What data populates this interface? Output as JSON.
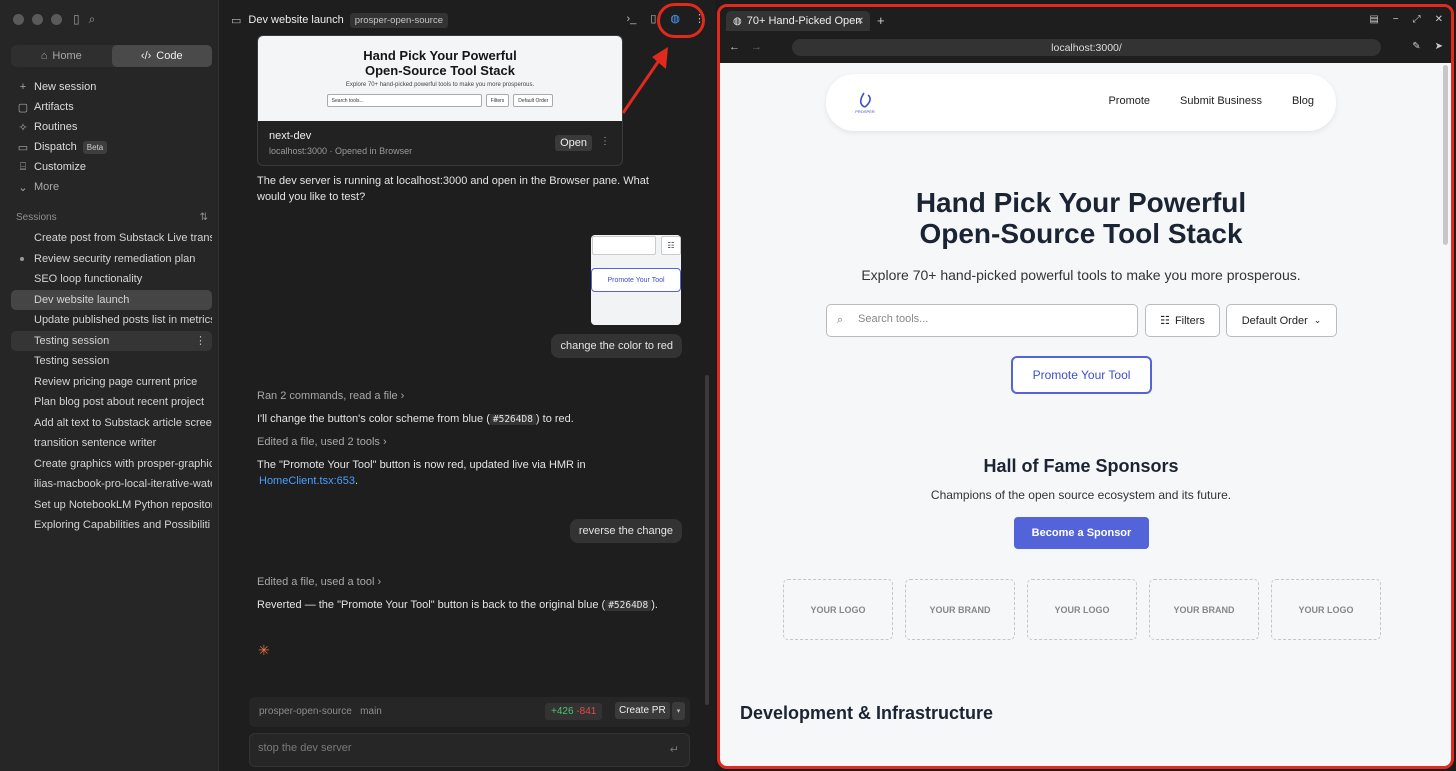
{
  "sidebar": {
    "tabs": [
      {
        "label": "Home",
        "icon": "home-icon"
      },
      {
        "label": "Code",
        "icon": "code-icon"
      }
    ],
    "nav": [
      {
        "label": "New session",
        "icon": "plus-icon"
      },
      {
        "label": "Artifacts",
        "icon": "artifacts-icon"
      },
      {
        "label": "Routines",
        "icon": "routines-icon"
      },
      {
        "label": "Dispatch",
        "icon": "dispatch-icon",
        "badge": "Beta"
      },
      {
        "label": "Customize",
        "icon": "customize-icon"
      },
      {
        "label": "More",
        "icon": "chevron-down-icon"
      }
    ],
    "sessions_label": "Sessions",
    "sessions": [
      "Create post from Substack Live trans",
      "Review security remediation plan",
      "SEO loop functionality",
      "Dev website launch",
      "Update published posts list in metrics",
      "Testing session",
      "Testing session",
      "Review pricing page current price",
      "Plan blog post about recent project",
      "Add alt text to Substack article scree",
      "transition sentence writer",
      "Create graphics with prosper-graphic",
      "ilias-macbook-pro-local-iterative-wate",
      "Set up NotebookLM Python repositor",
      "Exploring Capabilities and Possibiliti"
    ]
  },
  "chat": {
    "title": "Dev website launch",
    "repo": "prosper-open-source",
    "preview": {
      "heading": "Hand Pick Your Powerful Open-Source Tool Stack",
      "sub": "Explore 70+ hand-picked powerful tools to make you more prosperous.",
      "search": "Search tools...",
      "filters": "Filters",
      "order": "Default Order",
      "name": "next-dev",
      "info": "localhost:3000 · Opened in Browser",
      "open_label": "Open"
    },
    "msg1": "The dev server is running at localhost:3000 and open in the Browser pane. What would you like to test?",
    "thumb_button": "Promote Your Tool",
    "user1": "change the color to red",
    "meta1": "Ran 2 commands, read a file  ›",
    "msg2_a": "I'll change the button's color scheme from blue (",
    "msg2_code": "#5264D8",
    "msg2_b": ") to red.",
    "meta2": "Edited a file, used 2 tools  ›",
    "msg3_a": "The \"Promote Your Tool\" button is now red, updated live via HMR in",
    "msg3_link": "HomeClient.tsx:653",
    "msg3_b": ".",
    "user2": "reverse the change",
    "meta3": "Edited a file, used a tool  ›",
    "msg4_a": "Reverted — the \"Promote Your Tool\" button is back to the original blue (",
    "msg4_code": "#5264D8",
    "msg4_b": ").",
    "branch": {
      "repo": "prosper-open-source",
      "name": "main",
      "added": "+426",
      "removed": "-841",
      "pr_label": "Create PR"
    },
    "input_placeholder": "stop the dev server"
  },
  "browser": {
    "tab_title": "70+ Hand-Picked Open",
    "url": "localhost:3000/",
    "site": {
      "logo_text": "PROSPER",
      "nav": [
        "Promote",
        "Submit Business",
        "Blog"
      ],
      "hero_line1": "Hand Pick Your Powerful",
      "hero_line2": "Open-Source Tool Stack",
      "hero_sub": "Explore 70+ hand-picked powerful tools to make you more prosperous.",
      "search_placeholder": "Search tools...",
      "filters": "Filters",
      "order": "Default Order",
      "promote": "Promote Your Tool",
      "hof_title": "Hall of Fame Sponsors",
      "hof_sub": "Champions of the open source ecosystem and its future.",
      "sponsor_btn": "Become a Sponsor",
      "logos": [
        "YOUR LOGO",
        "YOUR BRAND",
        "YOUR LOGO",
        "YOUR BRAND",
        "YOUR LOGO"
      ],
      "section": "Development & Infrastructure"
    }
  },
  "colors": {
    "accent": "#5264D8",
    "highlight": "#E02A1E",
    "added": "#4CC36C",
    "removed": "#E5484D"
  }
}
